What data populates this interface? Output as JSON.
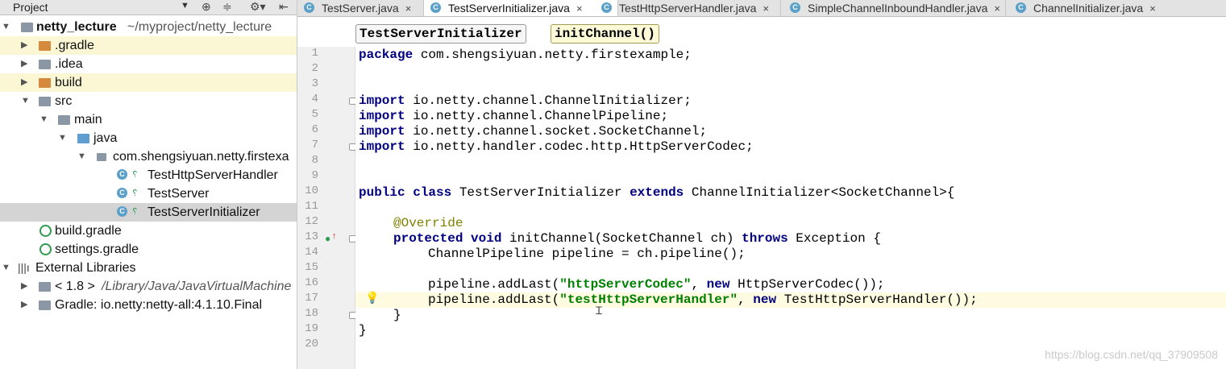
{
  "project_panel": {
    "title": "Project",
    "dropdown_icon": "chevron-down-icon",
    "tool_icons": [
      "target-icon",
      "collapse-icon",
      "gear-icon",
      "hide-icon"
    ],
    "tree": [
      {
        "label": "netty_lecture",
        "suffix": "~/myproject/netty_lecture",
        "icon": "module-folder-icon"
      },
      {
        "label": ".gradle",
        "icon": "folder-icon"
      },
      {
        "label": ".idea",
        "icon": "folder-icon"
      },
      {
        "label": "build",
        "icon": "folder-icon"
      },
      {
        "label": "src",
        "icon": "folder-icon"
      },
      {
        "label": "main",
        "icon": "folder-icon"
      },
      {
        "label": "java",
        "icon": "source-folder-icon"
      },
      {
        "label": "com.shengsiyuan.netty.firstexa",
        "icon": "package-icon"
      },
      {
        "label": "TestHttpServerHandler",
        "icon": "class-icon"
      },
      {
        "label": "TestServer",
        "icon": "class-icon"
      },
      {
        "label": "TestServerInitializer",
        "icon": "class-icon"
      },
      {
        "label": "build.gradle",
        "icon": "gradle-icon"
      },
      {
        "label": "settings.gradle",
        "icon": "gradle-icon"
      },
      {
        "label": "External Libraries",
        "icon": "library-icon"
      },
      {
        "label": "< 1.8 >",
        "suffix": "/Library/Java/JavaVirtualMachine",
        "icon": "jdk-icon"
      },
      {
        "label": "Gradle: io.netty:netty-all:4.1.10.Final",
        "icon": "library-jar-icon"
      }
    ]
  },
  "tabs": [
    {
      "label": "TestServer.java"
    },
    {
      "label": "TestServerInitializer.java",
      "active": true
    },
    {
      "label": "TestHttpServerHandler.java"
    },
    {
      "label": "SimpleChannelInboundHandler.java"
    },
    {
      "label": "ChannelInitializer.java"
    }
  ],
  "tab_close": "×",
  "breadcrumbs": [
    "TestServerInitializer",
    "initChannel()"
  ],
  "line_numbers": [
    "1",
    "2",
    "3",
    "4",
    "5",
    "6",
    "7",
    "8",
    "9",
    "10",
    "11",
    "12",
    "13",
    "14",
    "15",
    "16",
    "17",
    "18",
    "19",
    "20"
  ],
  "code": {
    "l1_kw": "package",
    "l1_rest": " com.shengsiyuan.netty.firstexample;",
    "import_kw": "import",
    "l4": " io.netty.channel.ChannelInitializer;",
    "l5": " io.netty.channel.ChannelPipeline;",
    "l6": " io.netty.channel.socket.SocketChannel;",
    "l7": " io.netty.handler.codec.http.HttpServerCodec;",
    "l10_public": "public",
    "l10_class": " class",
    "l10_name": " TestServerInitializer ",
    "l10_extends": "extends",
    "l10_rest": " ChannelInitializer<SocketChannel>{",
    "l12": "@Override",
    "l13_protected": "protected",
    "l13_void": " void",
    "l13_mid": " initChannel(SocketChannel ch) ",
    "l13_throws": "throws",
    "l13_rest": " Exception {",
    "l14": "ChannelPipeline pipeline = ch.pipeline();",
    "l16_a": "pipeline.addLast(",
    "l16_str": "\"httpServerCodec\"",
    "l16_b": ", ",
    "l16_new": "new",
    "l16_c": " HttpServerCodec());",
    "l17_a": "pipeline.addLast(",
    "l17_str": "\"testHttpServerHandler\"",
    "l17_b": ", ",
    "l17_new": "new",
    "l17_c": " TestHttpServerHandler());",
    "l18": "}",
    "l19": "}"
  },
  "watermark": "https://blog.csdn.net/qq_37909508"
}
